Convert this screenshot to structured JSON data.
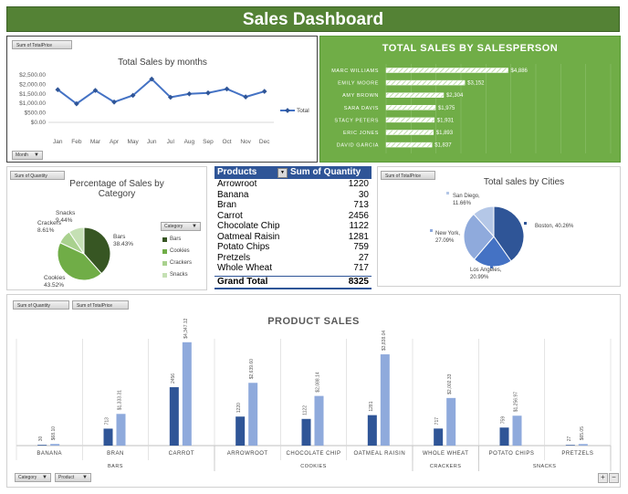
{
  "dashboard_title": "Sales Dashboard",
  "colors": {
    "title_bg": "#548235",
    "salesperson_bg": "#70ad47",
    "line": "#4472c4",
    "bar_qty": "#2f5597",
    "bar_price": "#8faadc",
    "pivot_header": "#2f5597"
  },
  "field_buttons": {
    "total_price": "Sum of TotalPrice",
    "quantity": "Sum of Quantity",
    "month": "Month",
    "category_filter": "Category",
    "product_filter": "Product"
  },
  "chart_data": [
    {
      "id": "monthly",
      "type": "line",
      "title": "Total Sales by months",
      "categories": [
        "Jan",
        "Feb",
        "Mar",
        "Apr",
        "May",
        "Jun",
        "Jul",
        "Aug",
        "Sep",
        "Oct",
        "Nov",
        "Dec"
      ],
      "series": [
        {
          "name": "Total",
          "values": [
            1720,
            980,
            1680,
            1070,
            1420,
            2280,
            1320,
            1500,
            1550,
            1760,
            1340,
            1630
          ]
        }
      ],
      "y_ticks": [
        "$0.00",
        "$500.00",
        "$1,000.00",
        "$1,500.00",
        "$2,000.00",
        "$2,500.00"
      ],
      "ylim": [
        0,
        2500
      ],
      "legend": "right"
    },
    {
      "id": "salesperson",
      "type": "bar",
      "orientation": "horizontal",
      "title": "TOTAL SALES BY SALESPERSON",
      "categories": [
        "MARC WILLIAMS",
        "EMILY MOORE",
        "AMY BROWN",
        "SARA DAVIS",
        "STACY PETERS",
        "ERIC JONES",
        "DAVID GARCIA"
      ],
      "values": [
        4886,
        3152,
        2304,
        1975,
        1931,
        1893,
        1837
      ],
      "value_labels": [
        "$4,886",
        "$3,152",
        "$2,304",
        "$1,975",
        "$1,931",
        "$1,893",
        "$1,837"
      ],
      "xlim": [
        0,
        9000
      ]
    },
    {
      "id": "category_pie",
      "type": "pie",
      "title": "Percentage of Sales by Category",
      "title_lines": [
        "Percentage of Sales by",
        "Category"
      ],
      "slices": [
        {
          "label": "Bars",
          "value": 38.43,
          "text": "38.43%",
          "color": "#375623"
        },
        {
          "label": "Cookies",
          "value": 43.52,
          "text": "43.52%",
          "color": "#70ad47"
        },
        {
          "label": "Crackers",
          "value": 8.61,
          "text": "8.61%",
          "color": "#a9d18e"
        },
        {
          "label": "Snacks",
          "value": 9.44,
          "text": "9.44%",
          "color": "#c5e0b4"
        }
      ],
      "legend_title": "Category",
      "legend": [
        "Bars",
        "Cookies",
        "Crackers",
        "Snacks"
      ]
    },
    {
      "id": "city_pie",
      "type": "pie",
      "title": "Total sales by Cities",
      "slices": [
        {
          "label": "Boston",
          "value": 40.26,
          "text": "40.26%",
          "color": "#2f5597"
        },
        {
          "label": "Los Angeles",
          "value": 20.99,
          "text": "20.99%",
          "color": "#4472c4"
        },
        {
          "label": "New York",
          "value": 27.09,
          "text": "27.09%",
          "color": "#8faadc"
        },
        {
          "label": "San Diego",
          "value": 11.66,
          "text": "11.66%",
          "color": "#b4c7e7"
        }
      ]
    },
    {
      "id": "product_table",
      "type": "table",
      "columns": [
        "Products",
        "Sum of Quantity"
      ],
      "rows": [
        [
          "Arrowroot",
          "1220"
        ],
        [
          "Banana",
          "30"
        ],
        [
          "Bran",
          "713"
        ],
        [
          "Carrot",
          "2456"
        ],
        [
          "Chocolate Chip",
          "1122"
        ],
        [
          "Oatmeal Raisin",
          "1281"
        ],
        [
          "Potato Chips",
          "759"
        ],
        [
          "Pretzels",
          "27"
        ],
        [
          "Whole Wheat",
          "717"
        ]
      ],
      "total": [
        "Grand Total",
        "8325"
      ]
    },
    {
      "id": "product_sales",
      "type": "bar",
      "title": "PRODUCT SALES",
      "categories": [
        "BANANA",
        "BRAN",
        "CARROT",
        "ARROWROOT",
        "CHOCOLATE CHIP",
        "OATMEAL RAISIN",
        "WHOLE WHEAT",
        "POTATO CHIPS",
        "PRETZELS"
      ],
      "groups": [
        {
          "name": "BARS",
          "members": [
            "BANANA",
            "BRAN",
            "CARROT"
          ]
        },
        {
          "name": "COOKIES",
          "members": [
            "ARROWROOT",
            "CHOCOLATE CHIP",
            "OATMEAL RAISIN"
          ]
        },
        {
          "name": "CRACKERS",
          "members": [
            "WHOLE WHEAT"
          ]
        },
        {
          "name": "SNACKS",
          "members": [
            "POTATO CHIPS",
            "PRETZELS"
          ]
        }
      ],
      "series": [
        {
          "values": [
            30,
            713,
            2456,
            1220,
            1122,
            1281,
            717,
            759,
            27
          ],
          "labels": [
            "30",
            "713",
            "2456",
            "1220",
            "1122",
            "1281",
            "717",
            "759",
            "27"
          ]
        },
        {
          "values": [
            68.1,
            1333.31,
            4347.12,
            2639.6,
            2088.14,
            3838.04,
            2002.33,
            1256.97,
            65.05
          ],
          "labels": [
            "$68.10",
            "$1,333.31",
            "$4,347.12",
            "$2,639.60",
            "$2,088.14",
            "$3,838.04",
            "$2,002.33",
            "$1,256.97",
            "$65.05"
          ]
        }
      ],
      "ylim": [
        0,
        4800
      ]
    }
  ]
}
